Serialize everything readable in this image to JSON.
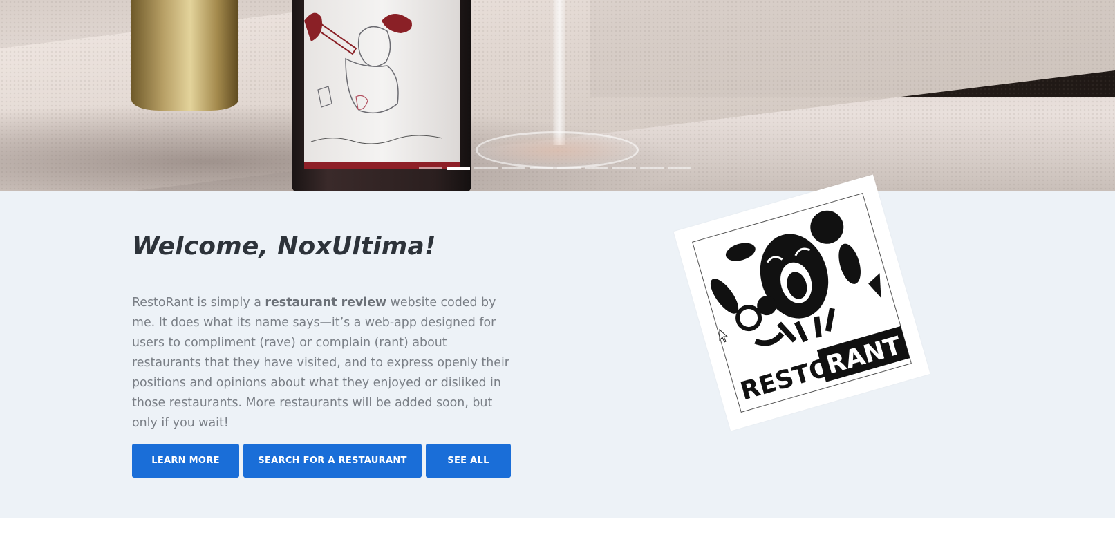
{
  "hero": {
    "carousel_indicator_count": 10,
    "carousel_active_index": 1
  },
  "welcome": {
    "heading": "Welcome, NoxUltima!",
    "intro_parts": {
      "before": "RestoRant is simply a ",
      "bold": "restaurant review",
      "after": " website coded by me. It does what its name says—it’s a web-app designed for users to compliment (rave) or complain (rant) about restaurants that they have visited, and to express openly their positions and opinions about what they enjoyed or disliked in those restaurants. More restaurants will be added soon, but only if you wait!"
    }
  },
  "buttons": {
    "learn_more": "LEARN MORE",
    "search": "SEARCH FOR A RESTAURANT",
    "see_all": "SEE ALL"
  },
  "logo": {
    "text_resto": "RESTO",
    "text_rant": "RANT"
  },
  "colors": {
    "primary_button": "#1a6ed8",
    "section_bg": "#edf2f7",
    "heading": "#2d333a",
    "body_text": "#7a7f86"
  }
}
